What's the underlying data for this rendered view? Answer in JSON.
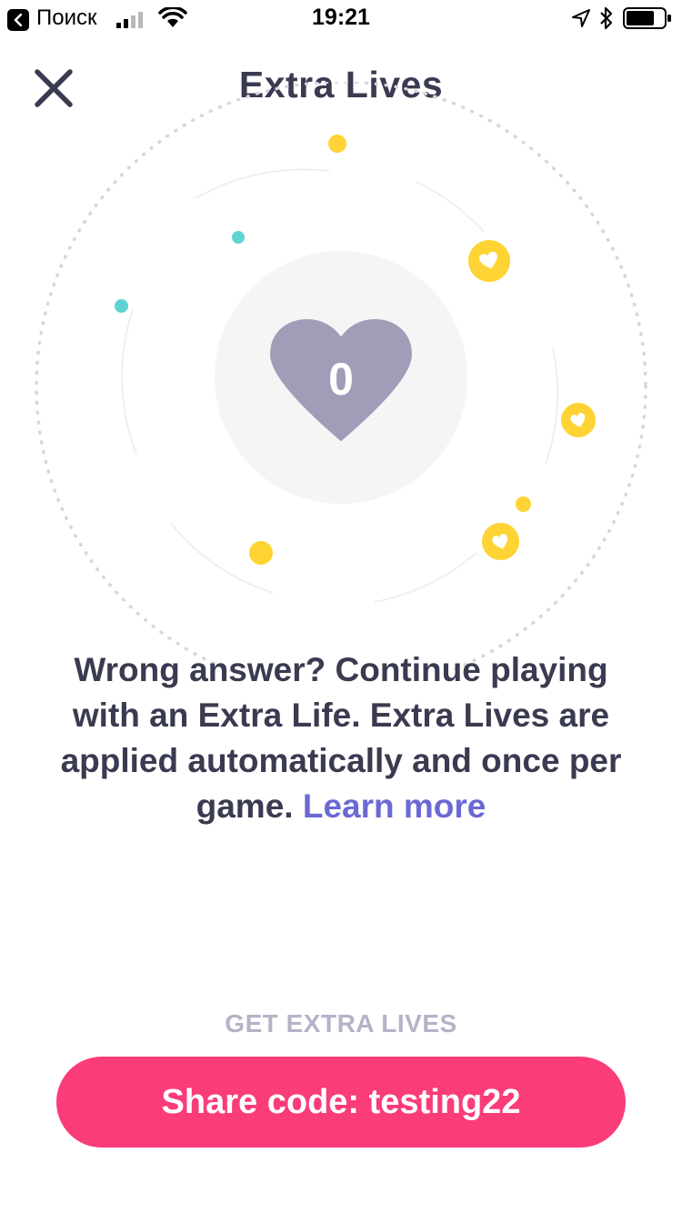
{
  "status_bar": {
    "carrier": "Поиск",
    "time": "19:21",
    "back_icon": "back-chevron-icon",
    "signal_icon": "cell-signal-icon",
    "wifi_icon": "wifi-icon",
    "location_icon": "location-arrow-icon",
    "bluetooth_icon": "bluetooth-icon",
    "battery_icon": "battery-icon"
  },
  "header": {
    "title": "Extra Lives",
    "close_icon": "close-icon"
  },
  "lives": {
    "count": "0",
    "icon": "heart-icon"
  },
  "description": {
    "text": "Wrong answer? Continue playing with an Extra Life. Extra Lives are applied automatically and once per game. ",
    "link": "Learn more"
  },
  "footer": {
    "section_label": "GET EXTRA LIVES",
    "share_button": "Share code: testing22"
  },
  "colors": {
    "accent_pink": "#fa3c78",
    "link_purple": "#6b69d4",
    "heart_gray": "#a09db8",
    "coin_yellow": "#fed333",
    "teal": "#5fd3d3",
    "text_dark": "#3a3b50",
    "label_gray": "#b4b3c8"
  }
}
